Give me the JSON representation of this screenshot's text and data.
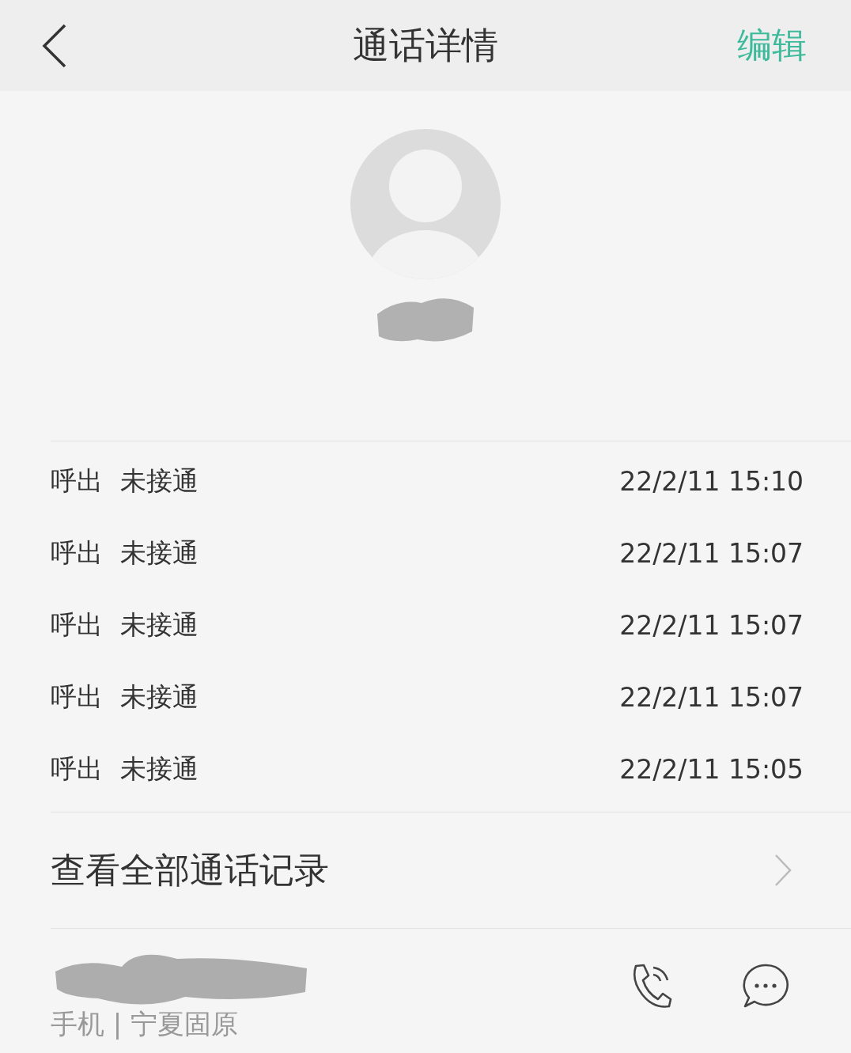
{
  "header": {
    "title": "通话详情",
    "action": "编辑"
  },
  "calls": [
    {
      "direction": "呼出",
      "status": "未接通",
      "time": "22/2/11 15:10"
    },
    {
      "direction": "呼出",
      "status": "未接通",
      "time": "22/2/11 15:07"
    },
    {
      "direction": "呼出",
      "status": "未接通",
      "time": "22/2/11 15:07"
    },
    {
      "direction": "呼出",
      "status": "未接通",
      "time": "22/2/11 15:07"
    },
    {
      "direction": "呼出",
      "status": "未接通",
      "time": "22/2/11 15:05"
    }
  ],
  "all_calls_link": "查看全部通话记录",
  "number": {
    "label": "手机 | 宁夏固原"
  }
}
